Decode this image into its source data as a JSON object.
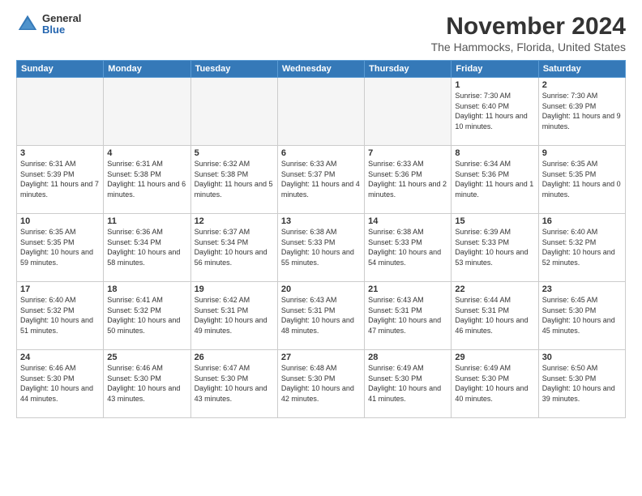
{
  "header": {
    "logo_general": "General",
    "logo_blue": "Blue",
    "main_title": "November 2024",
    "subtitle": "The Hammocks, Florida, United States"
  },
  "calendar": {
    "days_of_week": [
      "Sunday",
      "Monday",
      "Tuesday",
      "Wednesday",
      "Thursday",
      "Friday",
      "Saturday"
    ],
    "weeks": [
      [
        {
          "day": "",
          "empty": true
        },
        {
          "day": "",
          "empty": true
        },
        {
          "day": "",
          "empty": true
        },
        {
          "day": "",
          "empty": true
        },
        {
          "day": "",
          "empty": true
        },
        {
          "day": "1",
          "sunrise": "Sunrise: 7:30 AM",
          "sunset": "Sunset: 6:40 PM",
          "daylight": "Daylight: 11 hours and 10 minutes."
        },
        {
          "day": "2",
          "sunrise": "Sunrise: 7:30 AM",
          "sunset": "Sunset: 6:39 PM",
          "daylight": "Daylight: 11 hours and 9 minutes."
        }
      ],
      [
        {
          "day": "3",
          "sunrise": "Sunrise: 6:31 AM",
          "sunset": "Sunset: 5:39 PM",
          "daylight": "Daylight: 11 hours and 7 minutes."
        },
        {
          "day": "4",
          "sunrise": "Sunrise: 6:31 AM",
          "sunset": "Sunset: 5:38 PM",
          "daylight": "Daylight: 11 hours and 6 minutes."
        },
        {
          "day": "5",
          "sunrise": "Sunrise: 6:32 AM",
          "sunset": "Sunset: 5:38 PM",
          "daylight": "Daylight: 11 hours and 5 minutes."
        },
        {
          "day": "6",
          "sunrise": "Sunrise: 6:33 AM",
          "sunset": "Sunset: 5:37 PM",
          "daylight": "Daylight: 11 hours and 4 minutes."
        },
        {
          "day": "7",
          "sunrise": "Sunrise: 6:33 AM",
          "sunset": "Sunset: 5:36 PM",
          "daylight": "Daylight: 11 hours and 2 minutes."
        },
        {
          "day": "8",
          "sunrise": "Sunrise: 6:34 AM",
          "sunset": "Sunset: 5:36 PM",
          "daylight": "Daylight: 11 hours and 1 minute."
        },
        {
          "day": "9",
          "sunrise": "Sunrise: 6:35 AM",
          "sunset": "Sunset: 5:35 PM",
          "daylight": "Daylight: 11 hours and 0 minutes."
        }
      ],
      [
        {
          "day": "10",
          "sunrise": "Sunrise: 6:35 AM",
          "sunset": "Sunset: 5:35 PM",
          "daylight": "Daylight: 10 hours and 59 minutes."
        },
        {
          "day": "11",
          "sunrise": "Sunrise: 6:36 AM",
          "sunset": "Sunset: 5:34 PM",
          "daylight": "Daylight: 10 hours and 58 minutes."
        },
        {
          "day": "12",
          "sunrise": "Sunrise: 6:37 AM",
          "sunset": "Sunset: 5:34 PM",
          "daylight": "Daylight: 10 hours and 56 minutes."
        },
        {
          "day": "13",
          "sunrise": "Sunrise: 6:38 AM",
          "sunset": "Sunset: 5:33 PM",
          "daylight": "Daylight: 10 hours and 55 minutes."
        },
        {
          "day": "14",
          "sunrise": "Sunrise: 6:38 AM",
          "sunset": "Sunset: 5:33 PM",
          "daylight": "Daylight: 10 hours and 54 minutes."
        },
        {
          "day": "15",
          "sunrise": "Sunrise: 6:39 AM",
          "sunset": "Sunset: 5:33 PM",
          "daylight": "Daylight: 10 hours and 53 minutes."
        },
        {
          "day": "16",
          "sunrise": "Sunrise: 6:40 AM",
          "sunset": "Sunset: 5:32 PM",
          "daylight": "Daylight: 10 hours and 52 minutes."
        }
      ],
      [
        {
          "day": "17",
          "sunrise": "Sunrise: 6:40 AM",
          "sunset": "Sunset: 5:32 PM",
          "daylight": "Daylight: 10 hours and 51 minutes."
        },
        {
          "day": "18",
          "sunrise": "Sunrise: 6:41 AM",
          "sunset": "Sunset: 5:32 PM",
          "daylight": "Daylight: 10 hours and 50 minutes."
        },
        {
          "day": "19",
          "sunrise": "Sunrise: 6:42 AM",
          "sunset": "Sunset: 5:31 PM",
          "daylight": "Daylight: 10 hours and 49 minutes."
        },
        {
          "day": "20",
          "sunrise": "Sunrise: 6:43 AM",
          "sunset": "Sunset: 5:31 PM",
          "daylight": "Daylight: 10 hours and 48 minutes."
        },
        {
          "day": "21",
          "sunrise": "Sunrise: 6:43 AM",
          "sunset": "Sunset: 5:31 PM",
          "daylight": "Daylight: 10 hours and 47 minutes."
        },
        {
          "day": "22",
          "sunrise": "Sunrise: 6:44 AM",
          "sunset": "Sunset: 5:31 PM",
          "daylight": "Daylight: 10 hours and 46 minutes."
        },
        {
          "day": "23",
          "sunrise": "Sunrise: 6:45 AM",
          "sunset": "Sunset: 5:30 PM",
          "daylight": "Daylight: 10 hours and 45 minutes."
        }
      ],
      [
        {
          "day": "24",
          "sunrise": "Sunrise: 6:46 AM",
          "sunset": "Sunset: 5:30 PM",
          "daylight": "Daylight: 10 hours and 44 minutes."
        },
        {
          "day": "25",
          "sunrise": "Sunrise: 6:46 AM",
          "sunset": "Sunset: 5:30 PM",
          "daylight": "Daylight: 10 hours and 43 minutes."
        },
        {
          "day": "26",
          "sunrise": "Sunrise: 6:47 AM",
          "sunset": "Sunset: 5:30 PM",
          "daylight": "Daylight: 10 hours and 43 minutes."
        },
        {
          "day": "27",
          "sunrise": "Sunrise: 6:48 AM",
          "sunset": "Sunset: 5:30 PM",
          "daylight": "Daylight: 10 hours and 42 minutes."
        },
        {
          "day": "28",
          "sunrise": "Sunrise: 6:49 AM",
          "sunset": "Sunset: 5:30 PM",
          "daylight": "Daylight: 10 hours and 41 minutes."
        },
        {
          "day": "29",
          "sunrise": "Sunrise: 6:49 AM",
          "sunset": "Sunset: 5:30 PM",
          "daylight": "Daylight: 10 hours and 40 minutes."
        },
        {
          "day": "30",
          "sunrise": "Sunrise: 6:50 AM",
          "sunset": "Sunset: 5:30 PM",
          "daylight": "Daylight: 10 hours and 39 minutes."
        }
      ]
    ]
  }
}
